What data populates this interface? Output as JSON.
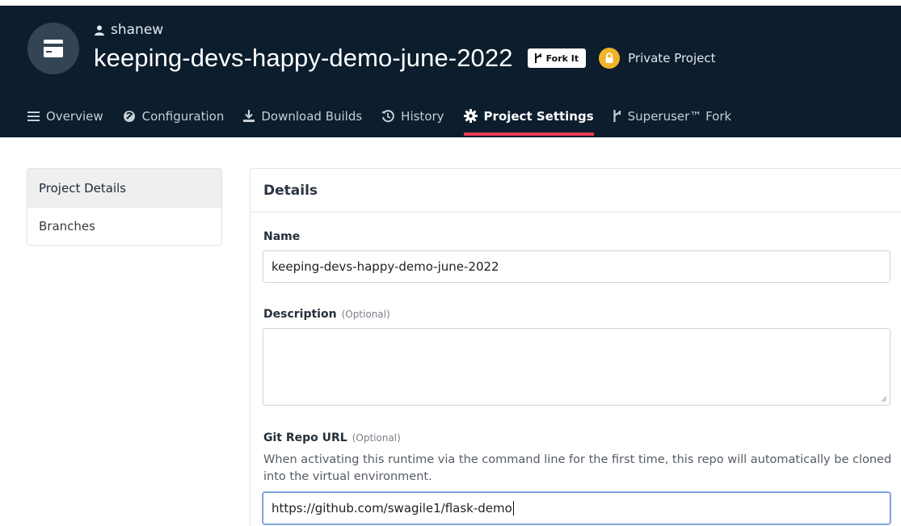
{
  "header": {
    "owner": "shanew",
    "project_title": "keeping-devs-happy-demo-june-2022",
    "fork_button": "Fork It",
    "privacy_label": "Private Project"
  },
  "nav": {
    "items": [
      {
        "label": "Overview",
        "icon": "list-icon"
      },
      {
        "label": "Configuration",
        "icon": "settings-cog-icon"
      },
      {
        "label": "Download Builds",
        "icon": "download-icon"
      },
      {
        "label": "History",
        "icon": "history-icon"
      },
      {
        "label": "Project Settings",
        "icon": "gear-icon",
        "active": true
      },
      {
        "label": "Superuser™ Fork",
        "icon": "fork-icon"
      }
    ]
  },
  "sidebar": {
    "items": [
      {
        "label": "Project Details",
        "active": true
      },
      {
        "label": "Branches"
      }
    ]
  },
  "details": {
    "heading": "Details",
    "name_label": "Name",
    "name_value": "keeping-devs-happy-demo-june-2022",
    "description_label": "Description",
    "description_optional": "(Optional)",
    "description_value": "",
    "git_label": "Git Repo URL",
    "git_optional": "(Optional)",
    "git_help": "When activating this runtime via the command line for the first time, this repo will automatically be cloned into the virtual environment.",
    "git_value": "https://github.com/swagile1/flask-demo"
  },
  "colors": {
    "header_bg": "#0c1d2d",
    "active_tab_underline": "#ea3b56",
    "lock_badge": "#f0b429"
  }
}
